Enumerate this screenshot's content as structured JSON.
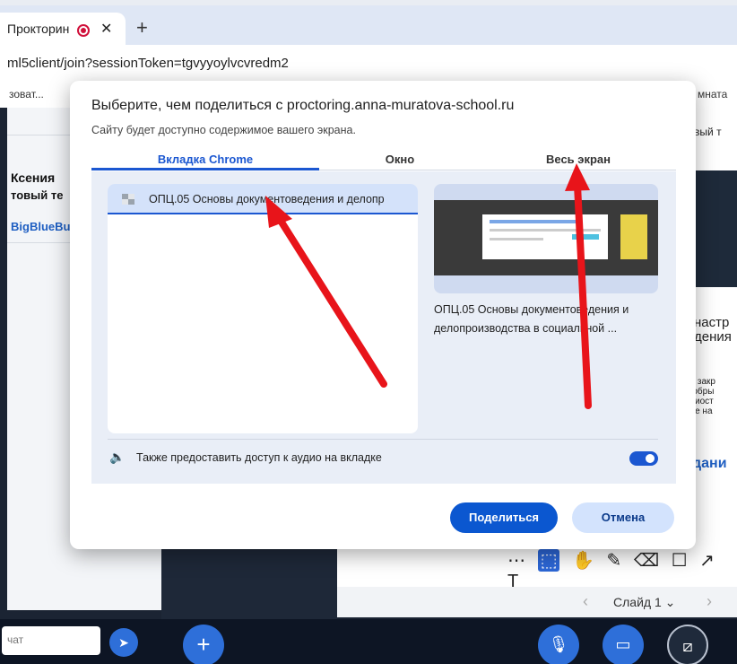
{
  "browser": {
    "tab_title": "Прокторин",
    "address": "ml5client/join?sessionToken=tgvyyoylvcvredm2",
    "bookmark_left": "зоват...",
    "bookmark_right": "мната"
  },
  "app": {
    "left": {
      "user_name": "Ксения",
      "user_sub": "товый те",
      "brand": "BigBlueBu"
    },
    "right": {
      "heading": "товый т",
      "section": "настр\nдения",
      "notice": "не закр\nи обры\nприост\nоне на",
      "link": "дани"
    },
    "slide_label": "Слайд 1",
    "chat_placeholder": "чат",
    "toolbar": [
      "⋯",
      "⬚",
      "✋",
      "✎",
      "⌫",
      "☐",
      "↗",
      "T"
    ]
  },
  "dialog": {
    "title": "Выберите, чем поделиться с proctoring.anna-muratova-school.ru",
    "subtitle": "Сайту будет доступно содержимое вашего экрана.",
    "tabs": [
      "Вкладка Chrome",
      "Окно",
      "Весь экран"
    ],
    "active_tab": 0,
    "list_item": "ОПЦ.05 Основы документоведения и делопр",
    "preview_caption": "ОПЦ.05 Основы документоведения и делопроизводства в социальной ...",
    "audio_label": "Также предоставить доступ к аудио на вкладке",
    "audio_enabled": true,
    "share_button": "Поделиться",
    "cancel_button": "Отмена"
  },
  "colors": {
    "accent": "#1b57d1",
    "annotation_arrow": "#e8141a"
  }
}
